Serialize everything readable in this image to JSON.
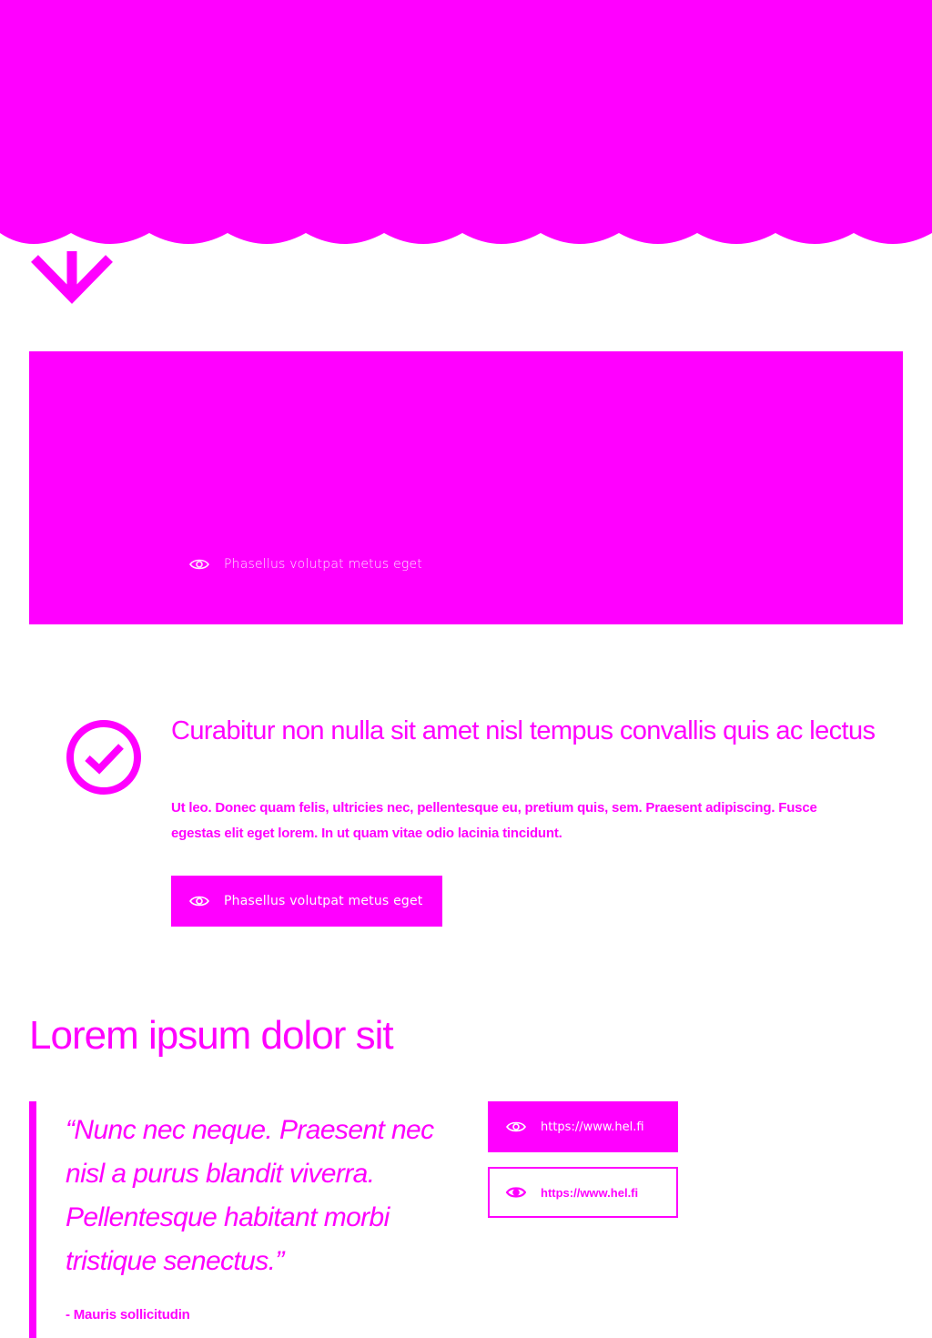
{
  "colors": {
    "accent": "#ff00ff",
    "background": "#ffffff",
    "on_accent": "#ffffff"
  },
  "hero": {
    "icon": "wave-edge",
    "scroll_icon": "arrow-down-icon"
  },
  "banner": {
    "link_label": "Phasellus volutpat metus eget",
    "link_icon": "eye-icon"
  },
  "feature": {
    "icon": "check-circle-icon",
    "title": "Curabitur non nulla sit amet nisl tempus convallis quis ac lectus",
    "text": "Ut leo. Donec quam felis, ultricies nec, pellentesque eu, pretium quis, sem. Praesent adipiscing. Fusce egestas elit eget lorem. In ut quam vitae odio lacinia tincidunt.",
    "button_label": "Phasellus volutpat metus eget",
    "button_icon": "eye-icon"
  },
  "section": {
    "title": "Lorem ipsum dolor sit"
  },
  "quote": {
    "text": "“Nunc nec neque. Praesent nec nisl a purus blandit viverra. Pellentesque habitant morbi tristique senectus.”",
    "author": "- Mauris sollicitudin"
  },
  "links": [
    {
      "label": "https://www.hel.fi",
      "icon": "eye-icon",
      "style": "filled"
    },
    {
      "label": "https://www.hel.fi",
      "icon": "eye-icon",
      "style": "outline"
    }
  ]
}
